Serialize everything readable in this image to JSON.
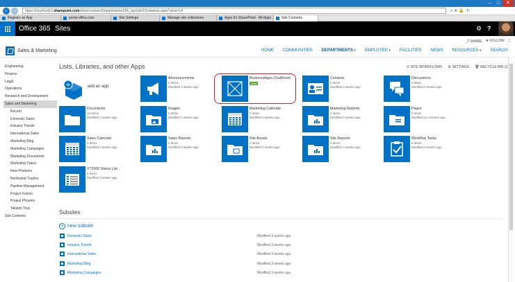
{
  "browser": {
    "url_prefix": "https://",
    "url_domain": "sharepoint.com",
    "url_host": "yourhost12.",
    "url_path": "/sites/contoso/Departments/SM/_layouts/15/viewlsts.aspx?view=14",
    "tabs": [
      {
        "label": "Register an App",
        "active": false
      },
      {
        "label": "portal.office.com",
        "active": false
      },
      {
        "label": "Site Settings",
        "active": false
      },
      {
        "label": "Manage site collections",
        "active": false
      },
      {
        "label": "Apps for SharePoint - All Apps",
        "active": false
      },
      {
        "label": "Site Contents",
        "active": true
      }
    ]
  },
  "suite": {
    "brand": "Office 365",
    "app": "Sites"
  },
  "actions": {
    "share": "SHARE",
    "follow": "FOLLOW"
  },
  "site": {
    "title": "Sales & Marketing",
    "topnav": [
      {
        "label": "HOME",
        "selected": false,
        "dropdown": false
      },
      {
        "label": "COMMUNITIES",
        "selected": false,
        "dropdown": false
      },
      {
        "label": "DEPARTMENTS",
        "selected": true,
        "dropdown": true
      },
      {
        "label": "EMPLOYEE",
        "selected": false,
        "dropdown": true
      },
      {
        "label": "FACILITIES",
        "selected": false,
        "dropdown": false
      },
      {
        "label": "NEWS",
        "selected": false,
        "dropdown": false
      },
      {
        "label": "RESOURCES",
        "selected": false,
        "dropdown": true
      },
      {
        "label": "SEARCH",
        "selected": false,
        "dropdown": false
      }
    ]
  },
  "leftnav": [
    {
      "label": "Engineering",
      "sub": false,
      "selected": false
    },
    {
      "label": "Finance",
      "sub": false,
      "selected": false
    },
    {
      "label": "Legal",
      "sub": false,
      "selected": false
    },
    {
      "label": "Operations",
      "sub": false,
      "selected": false
    },
    {
      "label": "Research and Development",
      "sub": false,
      "selected": false
    },
    {
      "label": "Sales and Marketing",
      "sub": false,
      "selected": true
    },
    {
      "label": "Recent",
      "sub": true,
      "selected": false
    },
    {
      "label": "Domestic Sales",
      "sub": true,
      "selected": false
    },
    {
      "label": "Industry Trends",
      "sub": true,
      "selected": false
    },
    {
      "label": "International Sales",
      "sub": true,
      "selected": false
    },
    {
      "label": "Marketing Blog",
      "sub": true,
      "selected": false
    },
    {
      "label": "Marketing Campaigns",
      "sub": true,
      "selected": false
    },
    {
      "label": "Marketing Documents",
      "sub": true,
      "selected": false
    },
    {
      "label": "Marketing Topics",
      "sub": true,
      "selected": false
    },
    {
      "label": "New Products",
      "sub": true,
      "selected": false
    },
    {
      "label": "Northwind Traders",
      "sub": true,
      "selected": false
    },
    {
      "label": "Pipeline Management",
      "sub": true,
      "selected": false
    },
    {
      "label": "Project Falcon",
      "sub": true,
      "selected": false
    },
    {
      "label": "Project Phoenix",
      "sub": true,
      "selected": false
    },
    {
      "label": "Tailspin Toys",
      "sub": true,
      "selected": false
    },
    {
      "label": "Site Contents",
      "sub": false,
      "selected": false
    }
  ],
  "content": {
    "heading": "Lists, Libraries, and other Apps",
    "toolbar": {
      "workflows": "SITE WORKFLOWS",
      "settings": "SETTINGS",
      "recycle": "RECYCLE BIN (2)"
    },
    "add_app": "add an app",
    "tiles": [
      {
        "name": "Announcements",
        "meta1": "0 items",
        "meta2": "Modified 3 weeks ago",
        "icon": "megaphone-icon"
      },
      {
        "name": "BusinessApps.ChatRoom",
        "meta1": "",
        "meta2": "",
        "badge": "new!",
        "icon": "app-placeholder-icon"
      },
      {
        "name": "Contacts",
        "meta1": "0 items",
        "meta2": "Modified 3 weeks ago",
        "icon": "contact-card-icon"
      },
      {
        "name": "Discussions",
        "meta1": "0 items",
        "meta2": "Modified 3 weeks ago",
        "icon": "speech-bubbles-icon"
      },
      {
        "name": "Documents",
        "meta1": "15 items",
        "meta2": "Modified 3 weeks ago",
        "icon": "folder-icon"
      },
      {
        "name": "Images",
        "meta1": "0 items",
        "meta2": "Modified 3 weeks ago",
        "icon": "image-folder-icon"
      },
      {
        "name": "Marketing Calendar",
        "meta1": "0 items",
        "meta2": "Modified 3 weeks ago",
        "icon": "calendar-icon"
      },
      {
        "name": "Marketing Reports",
        "meta1": "1 items",
        "meta2": "Modified 3 weeks ago",
        "icon": "report-folder-icon"
      },
      {
        "name": "Pages",
        "meta1": "0 items",
        "meta2": "Modified 11 minutes ago",
        "icon": "pages-folder-icon"
      },
      {
        "name": "Sales Calendar",
        "meta1": "0 items",
        "meta2": "Modified 3 weeks ago",
        "icon": "calendar-icon"
      },
      {
        "name": "Sales Reports",
        "meta1": "0 items",
        "meta2": "Modified 3 weeks ago",
        "icon": "report-folder-icon"
      },
      {
        "name": "Site Assets",
        "meta1": "0 items",
        "meta2": "Modified 3 weeks ago",
        "icon": "assets-folder-icon"
      },
      {
        "name": "Site Reports",
        "meta1": "0 items",
        "meta2": "Modified 3 weeks ago",
        "icon": "report-folder-icon"
      },
      {
        "name": "Workflow Tasks",
        "meta1": "0 items",
        "meta2": "Modified 3 weeks ago",
        "icon": "task-check-icon"
      },
      {
        "name": "XT2000 Status List",
        "meta1": "0 items",
        "meta2": "Modified 3 weeks ago",
        "icon": "list-icon"
      }
    ],
    "subsites_heading": "Subsites",
    "new_subsite": "new subsite",
    "subsites": [
      {
        "name": "Domestic Sales",
        "modified": "Modified 3 weeks ago"
      },
      {
        "name": "Industry Trends",
        "modified": "Modified 3 weeks ago"
      },
      {
        "name": "International Sales",
        "modified": "Modified 3 weeks ago"
      },
      {
        "name": "Marketing Blog",
        "modified": "Modified 3 weeks ago"
      },
      {
        "name": "Marketing Campaigns",
        "modified": "Modified 3 weeks ago"
      }
    ]
  },
  "colors": {
    "brand_blue": "#0072c6",
    "highlight_red": "#d0202a",
    "new_green": "#5da832"
  }
}
